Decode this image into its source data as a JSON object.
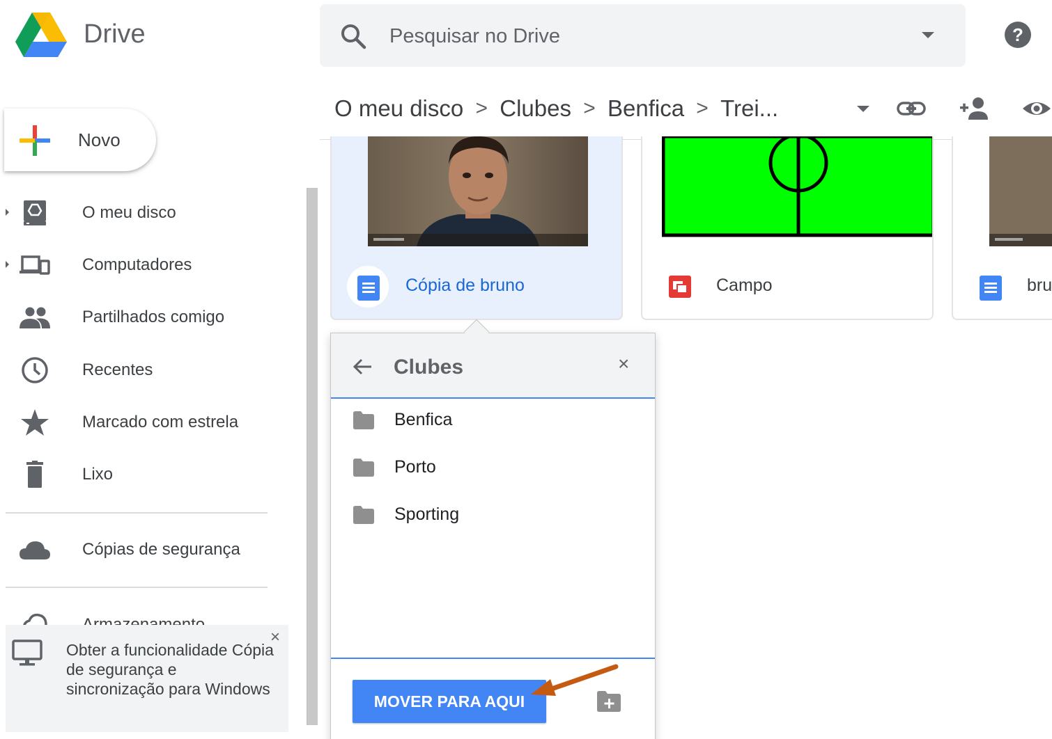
{
  "app": {
    "name": "Drive"
  },
  "search": {
    "placeholder": "Pesquisar no Drive"
  },
  "breadcrumb": {
    "items": [
      "O meu disco",
      "Clubes",
      "Benfica",
      "Trei..."
    ],
    "separator": ">"
  },
  "toolbar": {
    "icons": [
      "link-icon",
      "add-person-icon",
      "preview-eye-icon"
    ],
    "help_icon": "help-icon"
  },
  "sidebar": {
    "new_label": "Novo",
    "items": [
      {
        "label": "O meu disco",
        "icon": "my-drive-icon"
      },
      {
        "label": "Computadores",
        "icon": "computers-icon"
      },
      {
        "label": "Partilhados comigo",
        "icon": "shared-icon"
      },
      {
        "label": "Recentes",
        "icon": "clock-icon"
      },
      {
        "label": "Marcado com estrela",
        "icon": "star-icon"
      },
      {
        "label": "Lixo",
        "icon": "trash-icon"
      },
      {
        "label": "Cópias de segurança",
        "icon": "cloud-icon"
      }
    ],
    "storage_label": "Armazenamento",
    "promo": {
      "text": "Obter a funcionalidade Cópia de segurança e sincronização para Windows",
      "close": "×"
    }
  },
  "files": [
    {
      "name": "Cópia de bruno",
      "type": "docs",
      "selected": true
    },
    {
      "name": "Campo",
      "type": "slides",
      "selected": false
    },
    {
      "name": "bru",
      "type": "docs",
      "selected": false
    }
  ],
  "move_dialog": {
    "title": "Clubes",
    "close": "×",
    "folders": [
      "Benfica",
      "Porto",
      "Sporting"
    ],
    "move_button": "MOVER PARA AQUI"
  },
  "colors": {
    "accent": "#4285f4",
    "selected_bg": "#e8f0fe",
    "selected_text": "#1967d2",
    "annotation_arrow": "#c55a11"
  }
}
